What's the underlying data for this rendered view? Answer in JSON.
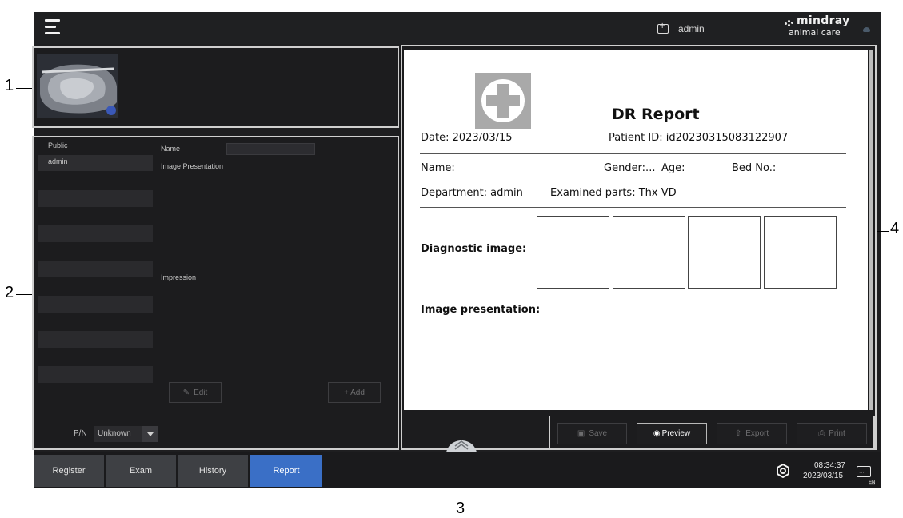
{
  "header": {
    "user": "admin",
    "brand_top": "mindray",
    "brand_bottom": "animal care"
  },
  "template_list": {
    "items": [
      "Public",
      "admin"
    ]
  },
  "editor": {
    "name_label": "Name",
    "image_presentation_label": "Image Presentation",
    "impression_label": "Impression",
    "edit_button": "Edit",
    "add_button": "+ Add",
    "pn_label": "P/N",
    "pn_value": "Unknown"
  },
  "report": {
    "title": "DR Report",
    "date": "Date: 2023/03/15",
    "patient_id": "Patient ID: id20230315083122907",
    "name": "Name:",
    "gender": "Gender:...",
    "age": "Age:",
    "bed": "Bed No.:",
    "department": "Department: admin",
    "examined_parts": "Examined parts:  Thx VD",
    "diagnostic_image": "Diagnostic image:",
    "image_presentation": "Image presentation:"
  },
  "report_toolbar": {
    "save": "Save",
    "preview": "Preview",
    "export": "Export",
    "print": "Print"
  },
  "bottom_tabs": [
    "Register",
    "Exam",
    "History",
    "Report"
  ],
  "active_tab": "Report",
  "status": {
    "time": "08:34:37",
    "date": "2023/03/15",
    "lang": "EN"
  },
  "callouts": [
    "1",
    "2",
    "3",
    "4"
  ],
  "colors": {
    "active_tab": "#3a6fc6",
    "screen_bg": "#1e1e20"
  }
}
